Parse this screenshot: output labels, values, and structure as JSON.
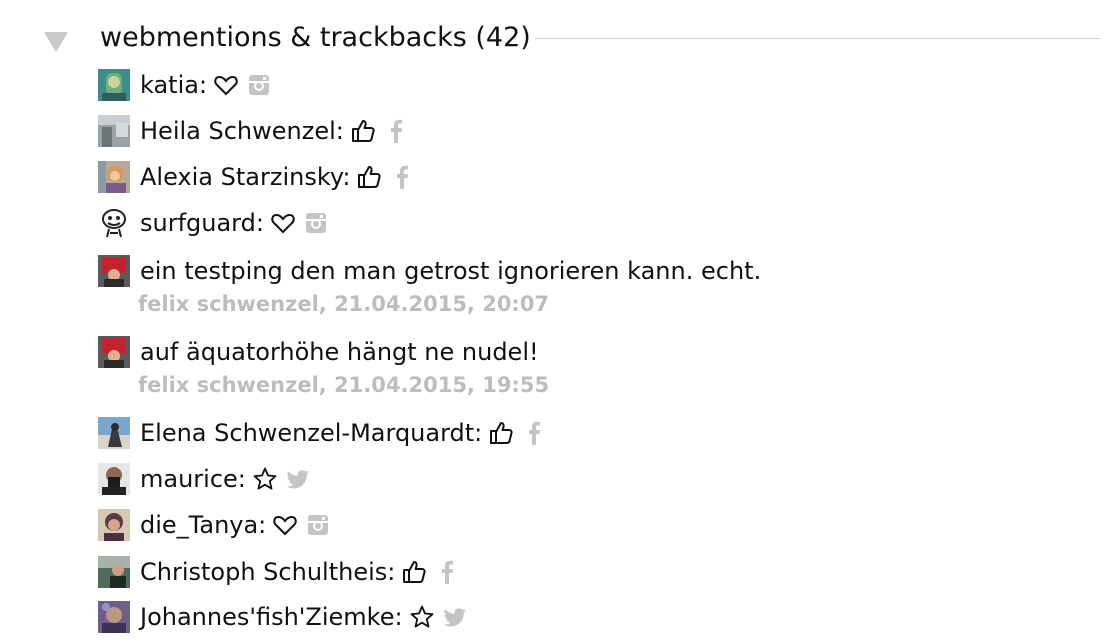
{
  "section": {
    "title": "webmentions & trackbacks (42)"
  },
  "colors": {
    "muted": "#bdbdbd",
    "text": "#111111",
    "rule": "#cfcfcf",
    "toggle": "#c9c9c9"
  },
  "items": [
    {
      "type": "reaction",
      "name": "katia:",
      "reaction_icon": "heart-outline-icon",
      "source_icon": "instagram-icon"
    },
    {
      "type": "reaction",
      "name": "Heila Schwenzel:",
      "reaction_icon": "thumbs-up-icon",
      "source_icon": "facebook-icon"
    },
    {
      "type": "reaction",
      "name": "Alexia Starzinsky:",
      "reaction_icon": "thumbs-up-icon",
      "source_icon": "facebook-icon"
    },
    {
      "type": "reaction",
      "name": "surfguard:",
      "reaction_icon": "heart-outline-icon",
      "source_icon": "instagram-icon"
    },
    {
      "type": "comment",
      "text": "ein testping den man getrost ignorieren kann. echt.",
      "meta": "felix schwenzel, 21.04.2015, 20:07"
    },
    {
      "type": "comment",
      "text": "auf äquatorhöhe hängt ne nudel!",
      "meta": "felix schwenzel, 21.04.2015, 19:55"
    },
    {
      "type": "reaction",
      "name": "Elena Schwenzel-Marquardt:",
      "reaction_icon": "thumbs-up-icon",
      "source_icon": "facebook-icon"
    },
    {
      "type": "reaction",
      "name": "maurice:",
      "reaction_icon": "star-outline-icon",
      "source_icon": "twitter-icon"
    },
    {
      "type": "reaction",
      "name": "die_Tanya:",
      "reaction_icon": "heart-outline-icon",
      "source_icon": "instagram-icon"
    },
    {
      "type": "reaction",
      "name": "Christoph Schultheis:",
      "reaction_icon": "thumbs-up-icon",
      "source_icon": "facebook-icon"
    },
    {
      "type": "reaction",
      "name": "Johannes'fish'Ziemke:",
      "reaction_icon": "star-outline-icon",
      "source_icon": "twitter-icon"
    }
  ]
}
